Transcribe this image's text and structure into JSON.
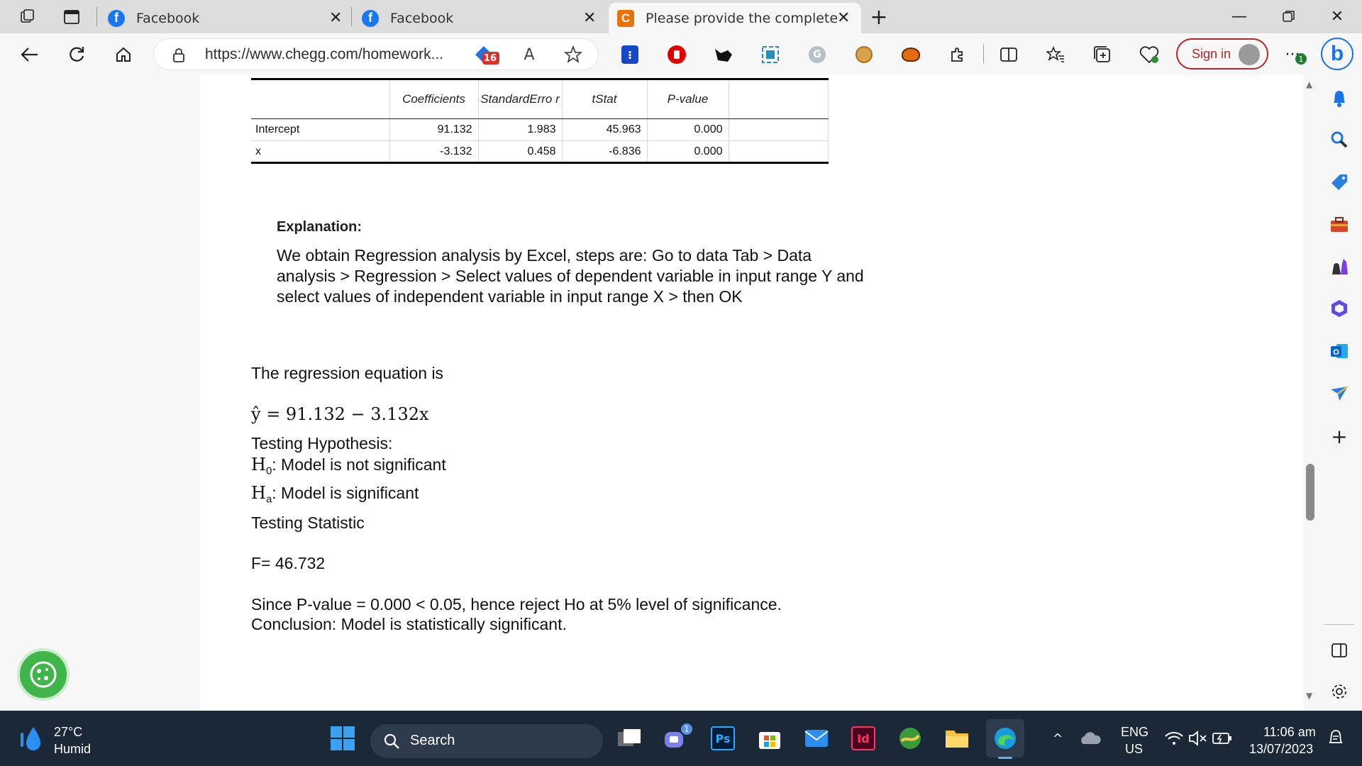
{
  "browser": {
    "tabs": [
      {
        "title": "Facebook"
      },
      {
        "title": "Facebook"
      },
      {
        "title": "Please provide the complete solu"
      }
    ],
    "new_tab": "+",
    "url": "https://www.chegg.com/homework...",
    "badge_count": "16",
    "read_aloud": "A",
    "sign_in": "Sign in",
    "notification_badge": "1"
  },
  "table": {
    "headers": [
      "",
      "Coefficients",
      "StandardErro r",
      "tStat",
      "P-value",
      ""
    ],
    "rows": [
      {
        "label": "Intercept",
        "coef": "91.132",
        "se": "1.983",
        "t": "45.963",
        "p": "0.000"
      },
      {
        "label": "x",
        "coef": "-3.132",
        "se": "0.458",
        "t": "-6.836",
        "p": "0.000"
      }
    ]
  },
  "content": {
    "explanation_heading": "Explanation:",
    "explanation_text": "We obtain Regression analysis by Excel, steps are: Go to data Tab > Data analysis > Regression > Select values of dependent variable in input range Y and select values of independent variable in input range X > then OK",
    "regression_intro": "The regression equation is",
    "equation": "ŷ = 91.132 − 3.132x",
    "testing_hypothesis": "Testing Hypothesis:",
    "h0_symbol": "H",
    "h0_sub": "0",
    "h0_text": ": Model is not significant",
    "ha_symbol": "H",
    "ha_sub": "a",
    "ha_text": ": Model is significant",
    "testing_statistic": "Testing Statistic",
    "f_value": "F= 46.732",
    "since_line": "Since P-value = 0.000 < 0.05, hence reject Ho at 5% level of significance.",
    "conclusion": "Conclusion: Model is statistically significant."
  },
  "taskbar": {
    "weather_temp": "27°C",
    "weather_desc": "Humid",
    "search_label": "Search",
    "teams_badge": "1",
    "ps_label": "Ps",
    "id_label": "Id",
    "lang_top": "ENG",
    "lang_bottom": "US",
    "time": "11:06 am",
    "date": "13/07/2023"
  },
  "colors": {
    "tabstrip": "#dcdcdc",
    "toolbar": "#f7f7f7",
    "taskbar": "#1b2838",
    "signin_accent": "#b4262a",
    "facebook_blue": "#1877f2",
    "chegg_orange": "#eb7100"
  }
}
